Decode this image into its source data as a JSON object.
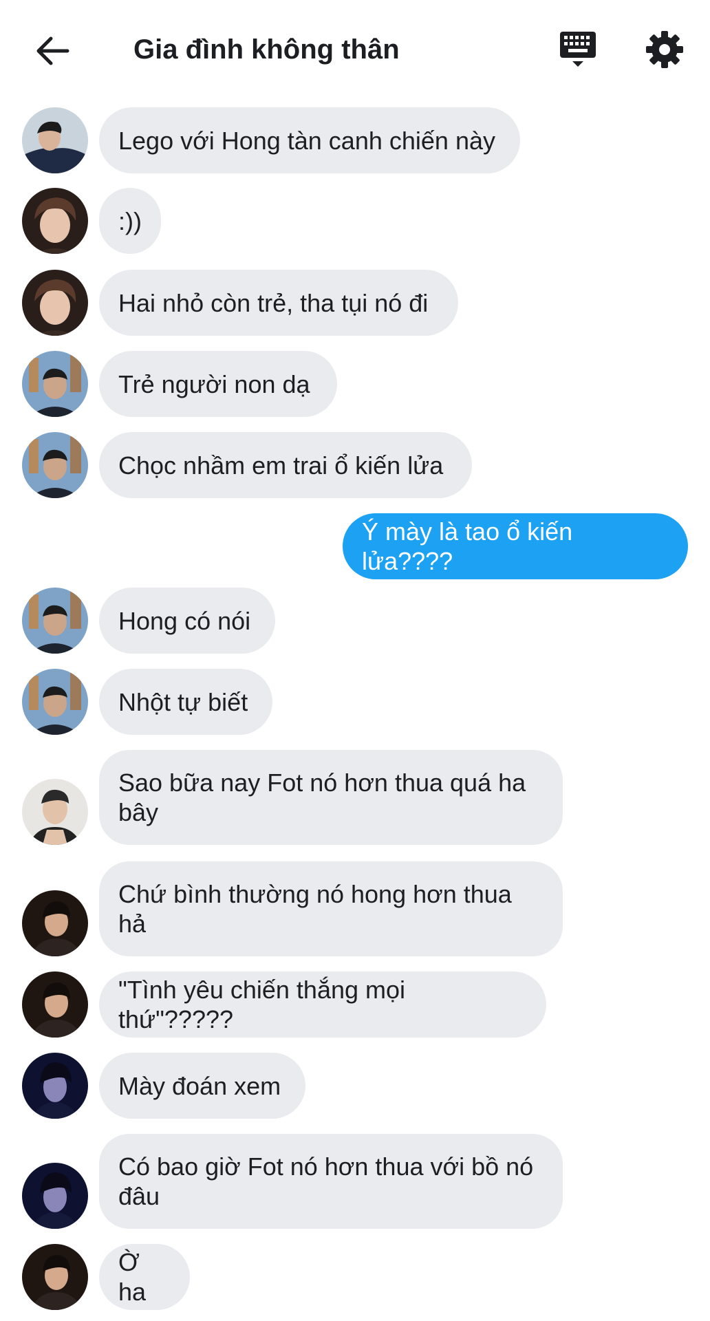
{
  "header": {
    "title": "Gia đình không thân",
    "back_icon": "arrow-left-icon",
    "keyboard_icon": "keyboard-icon",
    "settings_icon": "gear-icon"
  },
  "colors": {
    "incoming_bubble": "#e9ebee",
    "outgoing_bubble": "#1da1f2"
  },
  "messages": [
    {
      "text": "Lego với Hong tàn canh chiến này",
      "direction": "incoming"
    },
    {
      "text": ":))",
      "direction": "incoming"
    },
    {
      "text": "Hai nhỏ còn trẻ, tha tụi nó đi",
      "direction": "incoming"
    },
    {
      "text": "Trẻ người non dạ",
      "direction": "incoming"
    },
    {
      "text": "Chọc nhầm em trai ổ kiến lửa",
      "direction": "incoming"
    },
    {
      "text": "Ý mày là tao ổ kiến lửa????",
      "direction": "outgoing"
    },
    {
      "text": "Hong có nói",
      "direction": "incoming"
    },
    {
      "text": "Nhột tự biết",
      "direction": "incoming"
    },
    {
      "text": "Sao bữa nay Fot nó hơn thua quá ha bây",
      "direction": "incoming"
    },
    {
      "text": "Chứ bình thường nó hong hơn thua hả",
      "direction": "incoming"
    },
    {
      "text": "\"Tình yêu chiến thắng mọi thứ\"?????",
      "direction": "incoming"
    },
    {
      "text": "Mày đoán xem",
      "direction": "incoming"
    },
    {
      "text": "Có bao giờ Fot nó hơn thua với bồ nó đâu",
      "direction": "incoming"
    },
    {
      "text": "Ờ ha",
      "direction": "incoming"
    }
  ]
}
